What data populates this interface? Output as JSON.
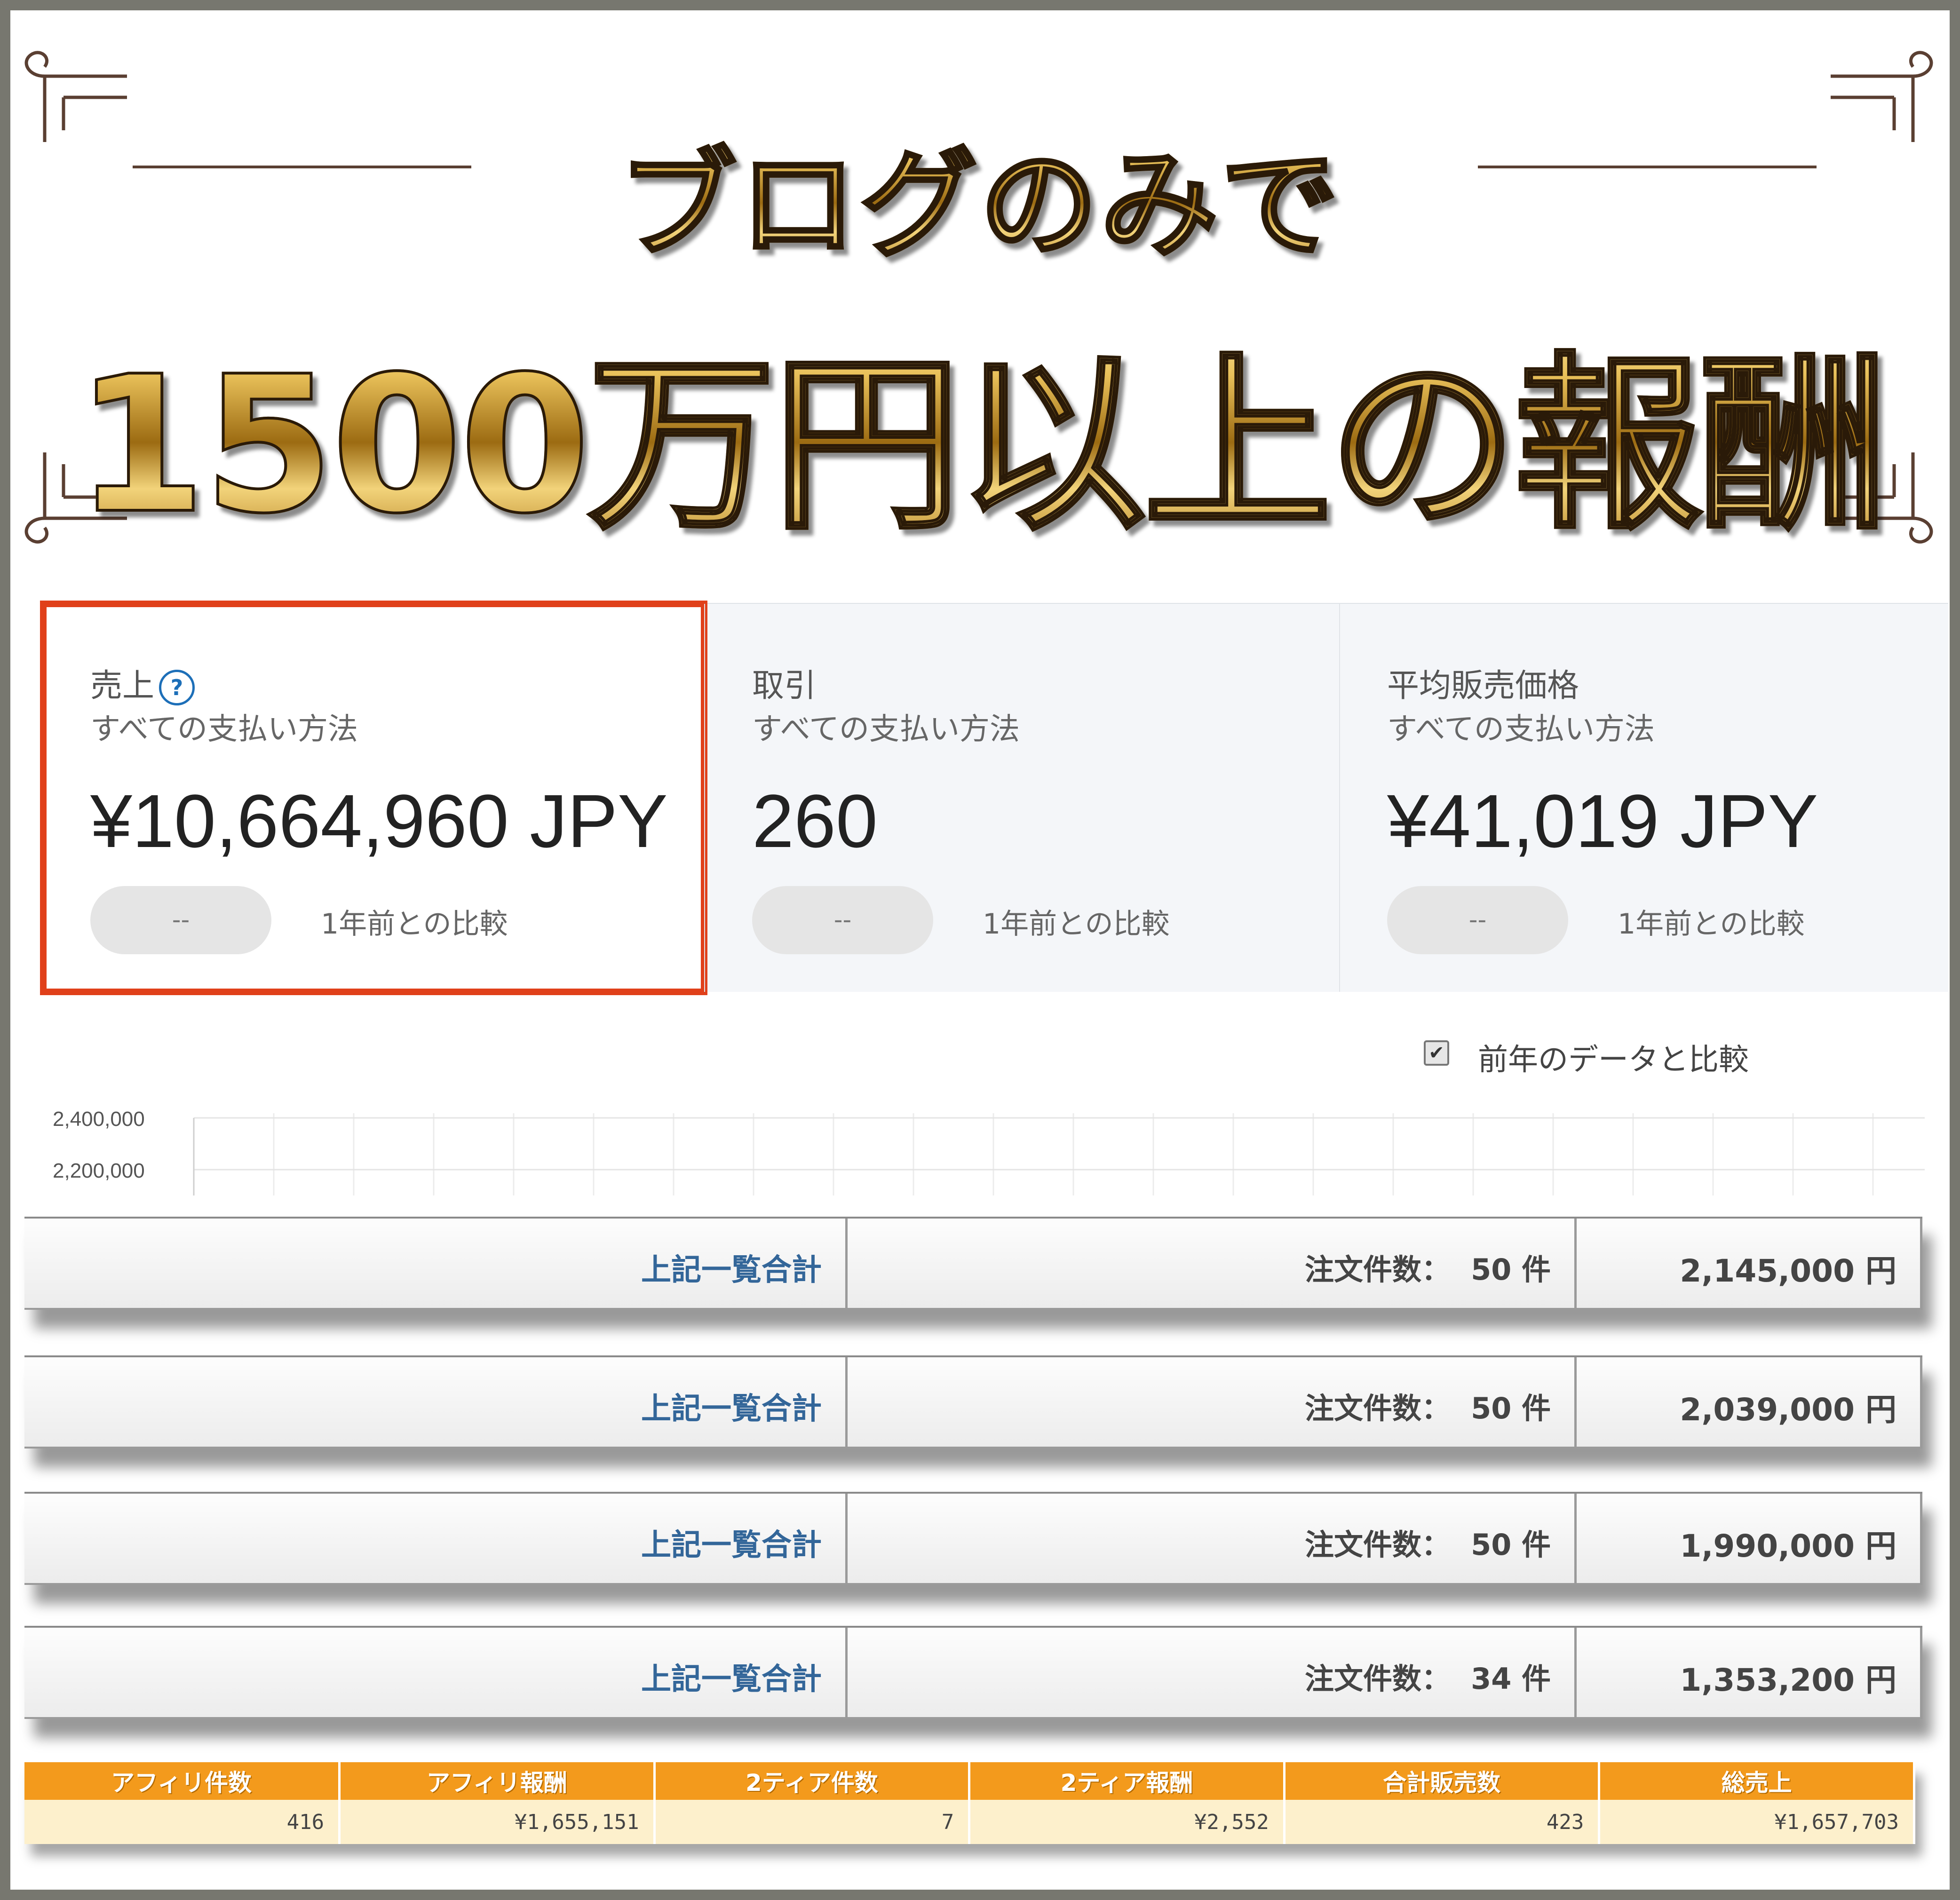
{
  "header": {
    "line1": "ブログのみで",
    "line2": "1500万円以上の報酬"
  },
  "stats": [
    {
      "title": "売上",
      "subtitle": "すべての支払い方法",
      "value": "¥10,664,960 JPY",
      "pill": "--",
      "compare": "1年前との比較",
      "highlighted": true
    },
    {
      "title": "取引",
      "subtitle": "すべての支払い方法",
      "value": "260",
      "pill": "--",
      "compare": "1年前との比較"
    },
    {
      "title": "平均販売価格",
      "subtitle": "すべての支払い方法",
      "value": "¥41,019 JPY",
      "pill": "--",
      "compare": "1年前との比較"
    }
  ],
  "chart": {
    "compare_checkbox_label": "前年のデータと比較",
    "compare_checked": true,
    "y_ticks": [
      "2,400,000",
      "2,200,000"
    ]
  },
  "summary_rows": [
    {
      "label": "上記一覧合計",
      "orders": "注文件数：  50 件",
      "amount": "2,145,000 円"
    },
    {
      "label": "上記一覧合計",
      "orders": "注文件数：  50 件",
      "amount": "2,039,000 円"
    },
    {
      "label": "上記一覧合計",
      "orders": "注文件数：  50 件",
      "amount": "1,990,000 円"
    },
    {
      "label": "上記一覧合計",
      "orders": "注文件数：  34 件",
      "amount": "1,353,200 円"
    }
  ],
  "affiliate_table": {
    "headers": [
      "アフィリ件数",
      "アフィリ報酬",
      "2ティア件数",
      "2ティア報酬",
      "合計販売数",
      "総売上"
    ],
    "row": [
      "416",
      "¥1,655,151",
      "7",
      "¥2,552",
      "423",
      "¥1,657,703"
    ]
  },
  "colors": {
    "highlight_border": "#e0401a",
    "summary_label": "#336699",
    "table_header": "#f39a1c",
    "table_row": "#fdf0cc",
    "frame_bg": "#77776f"
  }
}
